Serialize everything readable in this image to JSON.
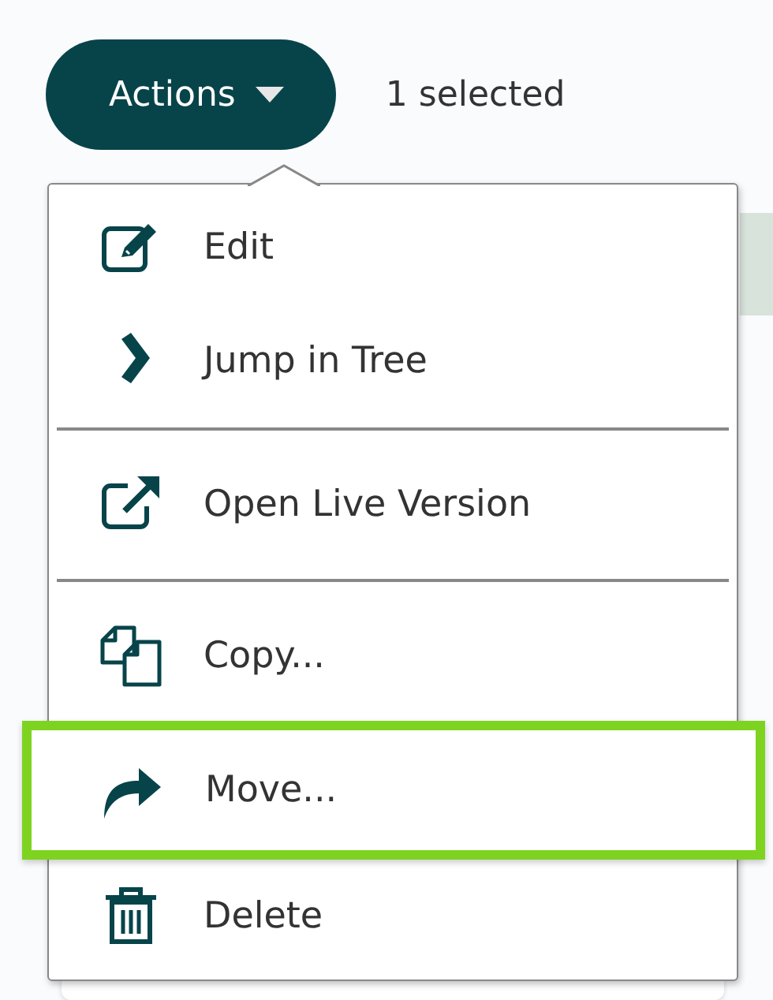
{
  "actions_button": {
    "label": "Actions"
  },
  "selection_count": "1 selected",
  "menu": {
    "items": [
      {
        "kind": "item",
        "label": "Edit",
        "highlighted": false
      },
      {
        "kind": "item",
        "label": "Jump in Tree",
        "highlighted": false
      },
      {
        "kind": "divider"
      },
      {
        "kind": "item",
        "label": "Open Live Version",
        "highlighted": false
      },
      {
        "kind": "divider"
      },
      {
        "kind": "item",
        "label": "Copy...",
        "highlighted": false
      },
      {
        "kind": "item",
        "label": "Move...",
        "highlighted": true
      },
      {
        "kind": "item",
        "label": "Delete",
        "highlighted": false
      }
    ]
  }
}
